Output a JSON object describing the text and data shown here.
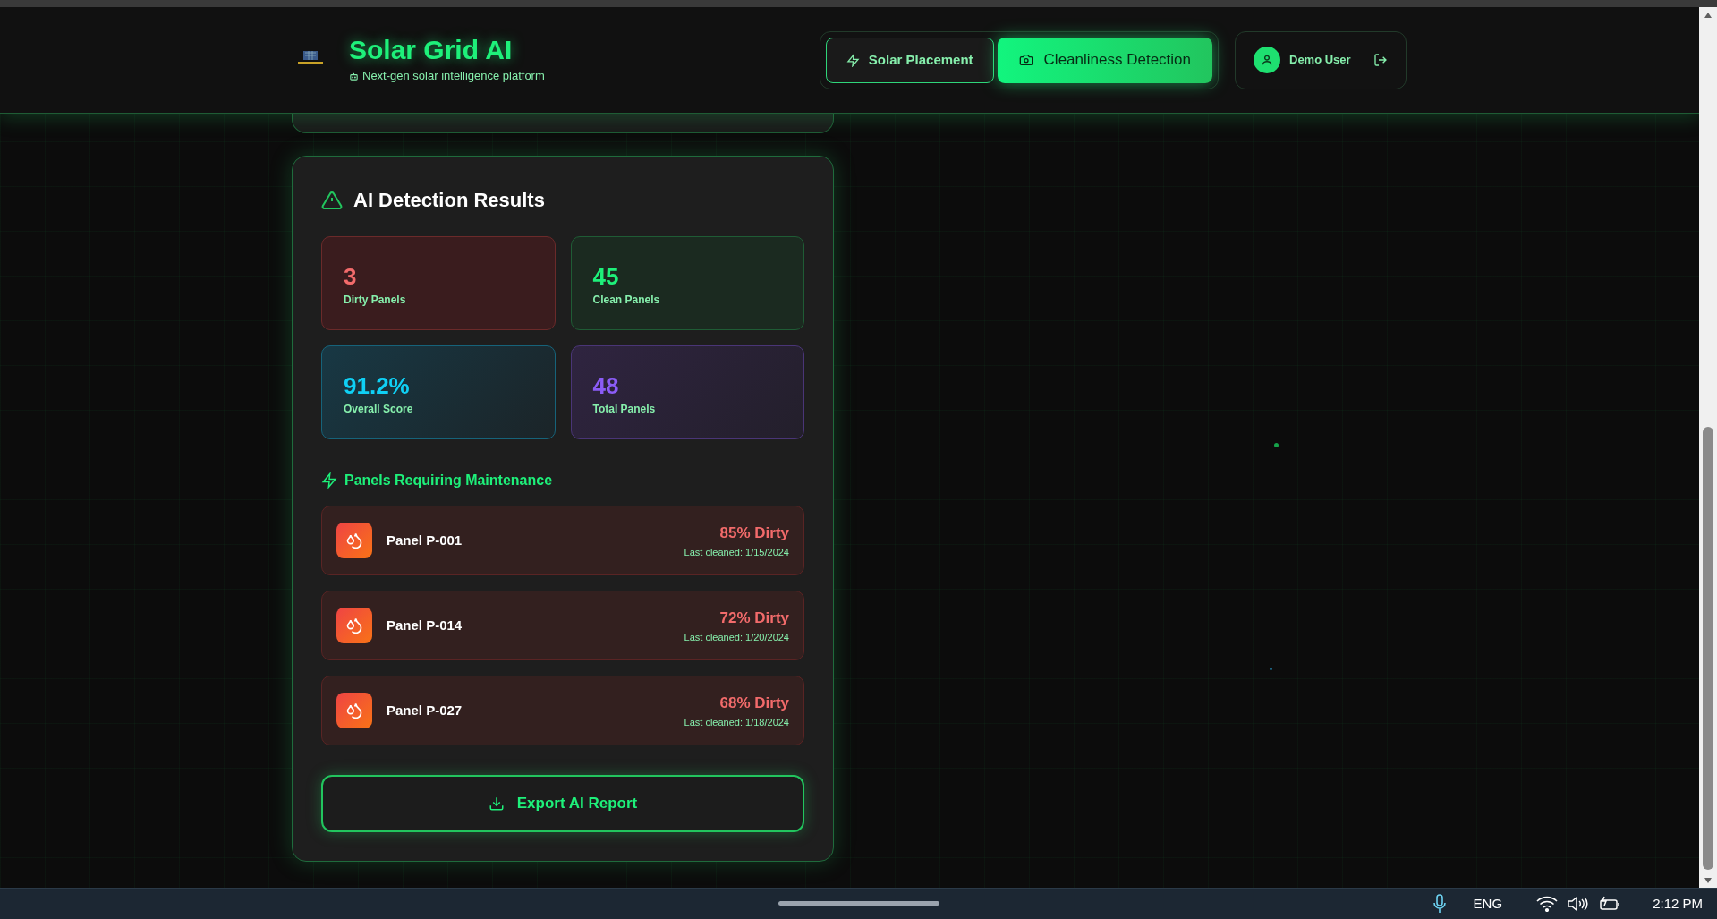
{
  "app": {
    "title": "Solar Grid AI",
    "subtitle": "Next-gen solar intelligence platform"
  },
  "nav_tabs": [
    {
      "label": "Solar Placement",
      "kind": "bolt",
      "selected": false
    },
    {
      "label": "Cleanliness Detection",
      "kind": "camera",
      "selected": true
    }
  ],
  "user": {
    "name": "Demo User"
  },
  "results": {
    "title": "AI Detection Results",
    "stats": [
      {
        "value": "3",
        "label": "Dirty Panels",
        "kind": "red",
        "color": "#f26b6b"
      },
      {
        "value": "45",
        "label": "Clean Panels",
        "kind": "green",
        "color": "#1ef07a"
      },
      {
        "value": "91.2%",
        "label": "Overall Score",
        "kind": "cyan",
        "color": "#0fd0f5"
      },
      {
        "value": "48",
        "label": "Total Panels",
        "kind": "violet",
        "color": "#8b5cf6"
      }
    ],
    "maintenance_title": "Panels Requiring Maintenance",
    "panels": [
      {
        "name": "Panel P-001",
        "dirt": "85% Dirty",
        "last_cleaned": "Last cleaned: 1/15/2024"
      },
      {
        "name": "Panel P-014",
        "dirt": "72% Dirty",
        "last_cleaned": "Last cleaned: 1/20/2024"
      },
      {
        "name": "Panel P-027",
        "dirt": "68% Dirty",
        "last_cleaned": "Last cleaned: 1/18/2024"
      }
    ],
    "export_button": "Export AI Report"
  },
  "taskbar": {
    "language": "ENG",
    "time": "2:12 PM"
  }
}
